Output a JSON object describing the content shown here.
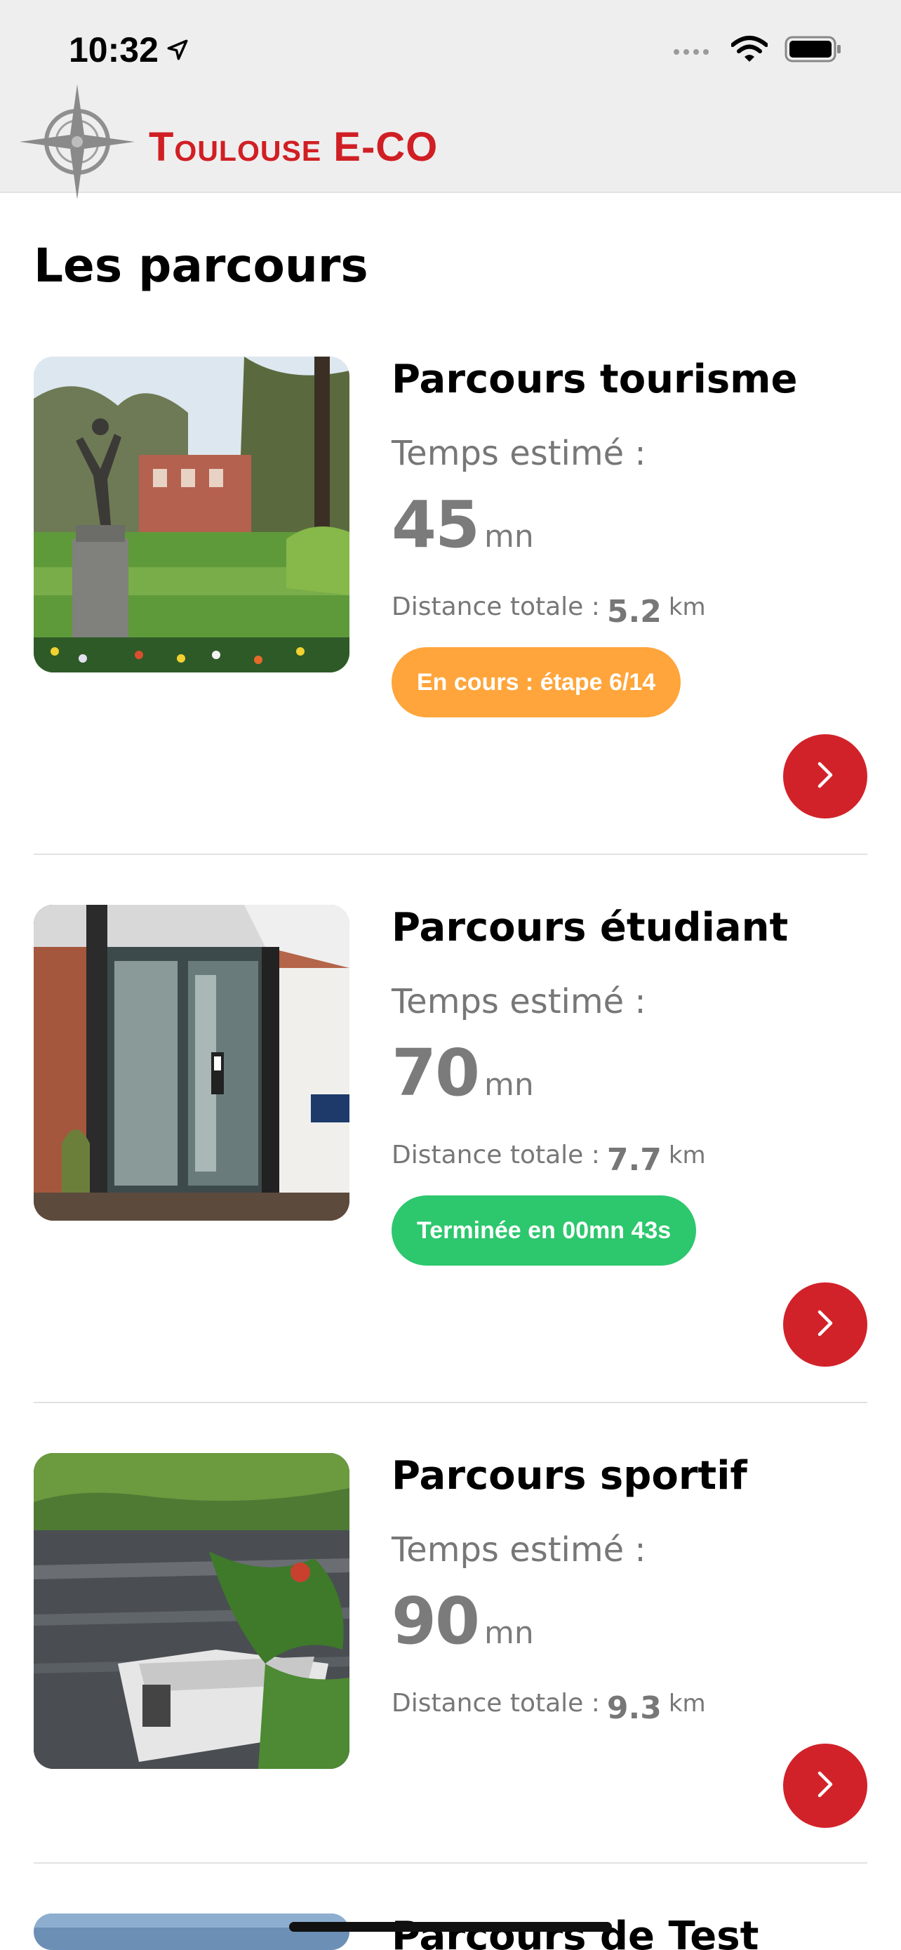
{
  "status_bar": {
    "time": "10:32",
    "icons": [
      "location-arrow-icon",
      "cellular-signal-icon",
      "wifi-icon",
      "battery-icon"
    ]
  },
  "header": {
    "logo_text": "Toulouse E-CO",
    "logo_icon": "compass-rose-icon"
  },
  "page": {
    "title": "Les parcours"
  },
  "colors": {
    "brand_red": "#d01f24",
    "in_progress": "#ffa53b",
    "completed": "#2dc76d",
    "muted_text": "#777777"
  },
  "courses": [
    {
      "title": "Parcours tourisme",
      "time_label": "Temps estimé :",
      "time_value": "45",
      "time_unit": "mn",
      "distance_label": "Distance totale :",
      "distance_value": "5.2",
      "distance_unit": "km",
      "status": "En cours : étape 6/14"
    },
    {
      "title": "Parcours étudiant",
      "time_label": "Temps estimé :",
      "time_value": "70",
      "time_unit": "mn",
      "distance_label": "Distance totale :",
      "distance_value": "7.7",
      "distance_unit": "km",
      "status": "Terminée en 00mn 43s"
    },
    {
      "title": "Parcours sportif",
      "time_label": "Temps estimé :",
      "time_value": "90",
      "time_unit": "mn",
      "distance_label": "Distance totale :",
      "distance_value": "9.3",
      "distance_unit": "km",
      "status": ""
    },
    {
      "title": "Parcours de Test"
    }
  ]
}
